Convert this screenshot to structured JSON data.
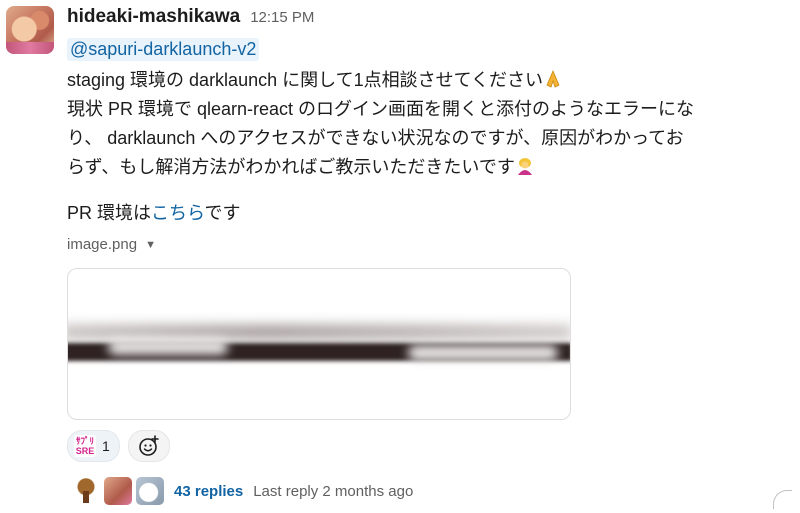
{
  "message": {
    "author": "hideaki-mashikawa",
    "time": "12:15 PM",
    "mention": "@sapuri-darklaunch-v2",
    "line1": "staging 環境の darklaunch に関して1点相談させてください",
    "line1_emoji": "folded-hands",
    "line2": "現状 PR 環境で qlearn-react のログイン画面を開くと添付のようなエラーにな",
    "line3": "り、 darklaunch へのアクセスができない状況なのですが、原因がわかってお",
    "line4": "らず、もし解消方法がわかればご教示いただきたいです",
    "line4_emoji": "person-bowing",
    "pr_prefix": "PR 環境は",
    "pr_link": "こちら",
    "pr_suffix": "です"
  },
  "attachment": {
    "filename": "image.png",
    "caret": "▼"
  },
  "reactions": [
    {
      "emoji_top": "ｻﾌﾟﾘ",
      "emoji_bottom": "SRE",
      "count": "1"
    }
  ],
  "add_reaction_icon": "add-emoji-icon",
  "thread": {
    "replies": "43 replies",
    "last_reply": "Last reply 2 months ago"
  },
  "colors": {
    "link": "#1264a3",
    "mention_bg": "#e8f3fb",
    "reaction_bg": "#eef3f8"
  }
}
